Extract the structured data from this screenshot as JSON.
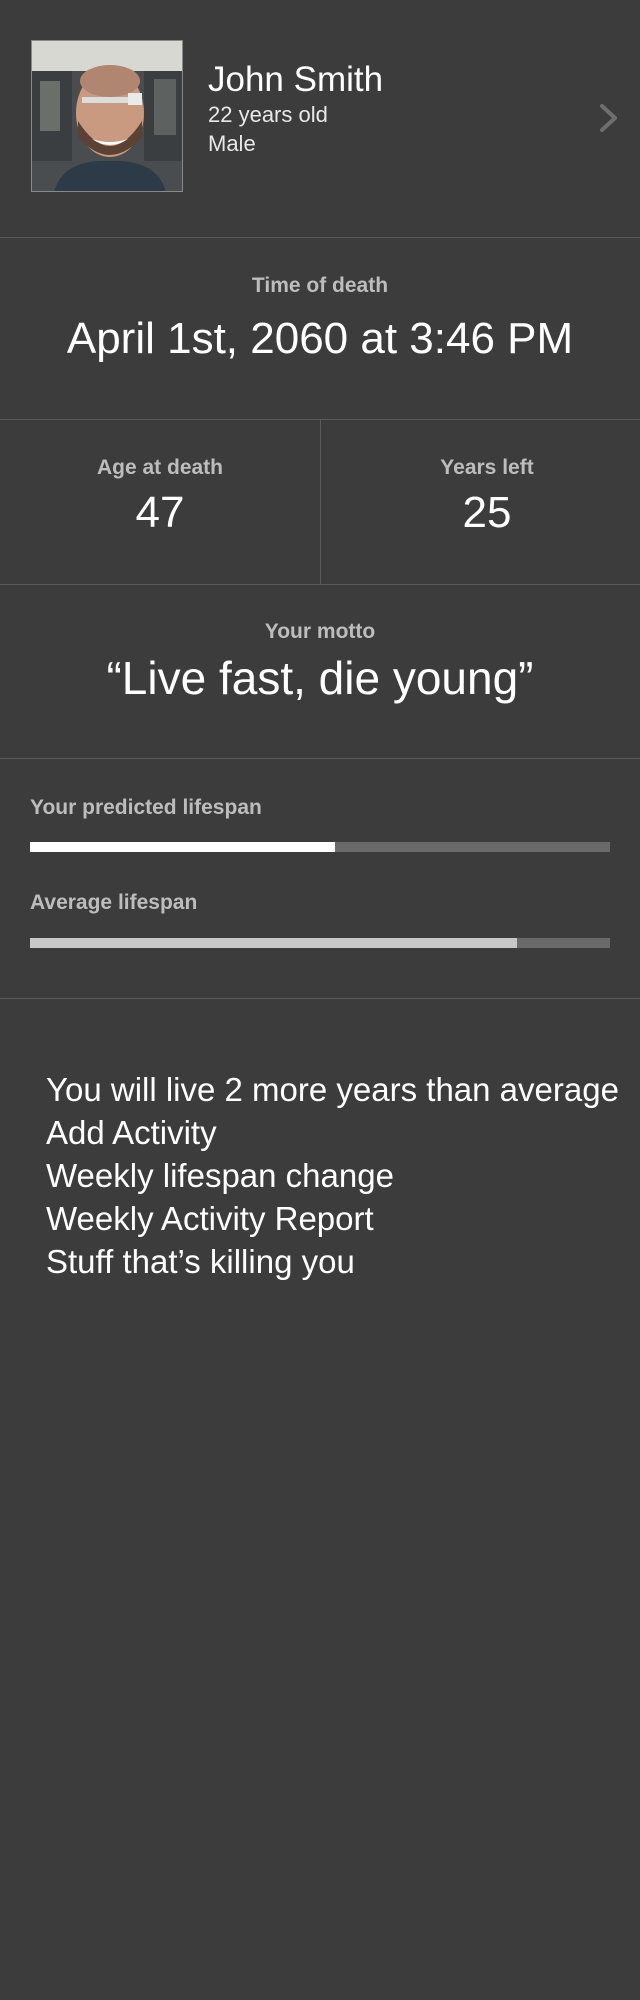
{
  "profile": {
    "name": "John Smith",
    "age": "22 years old",
    "gender": "Male",
    "avatar_icon": "person-photo",
    "chevron_icon": "chevron-right-icon"
  },
  "time_of_death": {
    "label": "Time of death",
    "value": "April 1st, 2060 at 3:46 PM"
  },
  "stats": {
    "age_at_death": {
      "label": "Age at death",
      "value": "47"
    },
    "years_left": {
      "label": "Years left",
      "value": "25"
    }
  },
  "motto": {
    "label": "Your motto",
    "value": "“Live fast, die young”"
  },
  "lifespan": {
    "predicted": {
      "label": "Your predicted lifespan",
      "fraction": 0.525,
      "color": "#ffffff"
    },
    "average": {
      "label": "Average lifespan",
      "fraction": 0.84,
      "color": "#c8c8c8"
    }
  },
  "menu": {
    "items": [
      "You will live 2 more years than average",
      "Add Activity",
      "Weekly lifespan change",
      "Weekly Activity Report",
      "Stuff that’s killing you"
    ]
  },
  "colors": {
    "background": "#3c3c3c",
    "divider": "#5a5a5a",
    "label": "#bdbdbd",
    "bar_track": "#6a6a6a"
  }
}
